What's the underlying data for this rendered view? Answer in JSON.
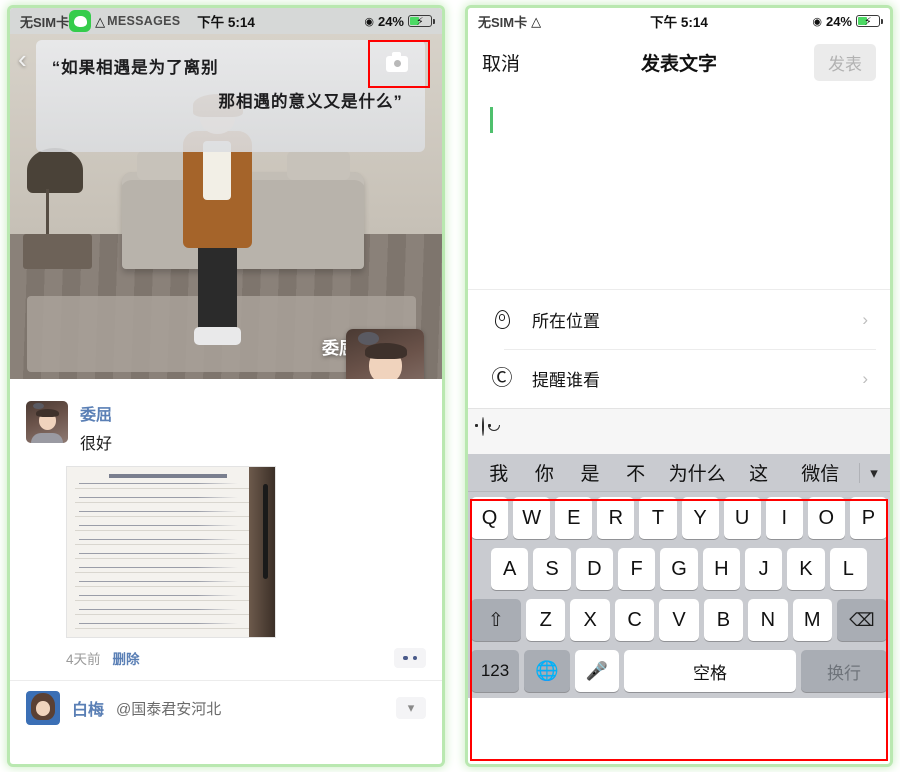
{
  "left": {
    "status": {
      "carrier": "无SIM卡",
      "app_label": "MESSAGES",
      "time": "下午 5:14",
      "battery": "24%"
    },
    "hero": {
      "quote_line1": "“如果相遇是为了离别",
      "quote_line2": "那相遇的意义又是什么”",
      "overlay_name": "委屈",
      "back_icon": "chevron-left-icon",
      "camera_icon": "camera-icon"
    },
    "comment": {
      "name": "委屈",
      "text": "很好"
    },
    "meta": {
      "time": "4天前",
      "delete": "删除",
      "more_icon": "more-dots-icon"
    },
    "last_row": {
      "name": "白梅",
      "handle": "@国泰君安河北",
      "chevron_icon": "chevron-down-icon"
    }
  },
  "right": {
    "status": {
      "carrier": "无SIM卡",
      "time": "下午 5:14",
      "battery": "24%"
    },
    "nav": {
      "cancel": "取消",
      "title": "发表文字",
      "post": "发表"
    },
    "compose": {
      "value": "",
      "placeholder": ""
    },
    "options": [
      {
        "label": "所在位置",
        "icon": "location-pin-icon"
      },
      {
        "label": "提醒谁看",
        "icon": "at-sign-icon"
      }
    ],
    "emoji_bar": {
      "icon": "smiley-face-icon"
    },
    "keyboard": {
      "predictions": [
        "我",
        "你",
        "是",
        "不",
        "为什么",
        "这",
        "微信"
      ],
      "collapse_icon": "chevron-down-icon",
      "row1": [
        "Q",
        "W",
        "E",
        "R",
        "T",
        "Y",
        "U",
        "I",
        "O",
        "P"
      ],
      "row2": [
        "A",
        "S",
        "D",
        "F",
        "G",
        "H",
        "J",
        "K",
        "L"
      ],
      "row3": [
        "Z",
        "X",
        "C",
        "V",
        "B",
        "N",
        "M"
      ],
      "shift_icon": "shift-arrow-icon",
      "delete_icon": "backspace-icon",
      "num_key": "123",
      "globe_icon": "globe-icon",
      "mic_icon": "microphone-icon",
      "space": "空格",
      "enter": "换行"
    }
  },
  "colors": {
    "accent_green": "#4fc06d",
    "link_blue": "#5a7fb5",
    "annotation_red": "#ff0000"
  }
}
